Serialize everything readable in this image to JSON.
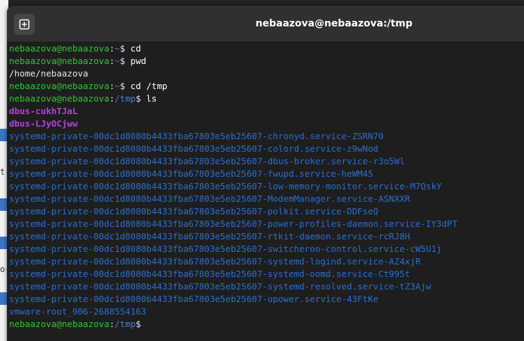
{
  "window": {
    "title": "nebaazova@nebaazova:/tmp",
    "new_tab_icon": "plus-in-square-icon"
  },
  "terminal": {
    "prompt_user": "nebaazova@nebaazova",
    "colors": {
      "user": "#33c534",
      "path": "#3e84d8",
      "sticky_dir": "#b044d8",
      "dir": "#2a6fcf",
      "text": "#e6e6e6"
    },
    "lines": [
      {
        "type": "prompt",
        "path": "~",
        "cmd": " cd"
      },
      {
        "type": "prompt",
        "path": "~",
        "cmd": " pwd"
      },
      {
        "type": "output",
        "text": "/home/nebaazova"
      },
      {
        "type": "prompt",
        "path": "~",
        "cmd": " cd /tmp"
      },
      {
        "type": "prompt",
        "path": "/tmp",
        "cmd": " ls"
      },
      {
        "type": "sticky",
        "text": "dbus-cukhTJaL"
      },
      {
        "type": "sticky",
        "text": "dbus-LJyOCjww"
      },
      {
        "type": "dir",
        "text": "systemd-private-00dc1d8080b4433fba67803e5eb25607-chronyd.service-ZSRN70"
      },
      {
        "type": "dir",
        "text": "systemd-private-00dc1d8080b4433fba67803e5eb25607-colord.service-z9wNod"
      },
      {
        "type": "dir",
        "text": "systemd-private-00dc1d8080b4433fba67803e5eb25607-dbus-broker.service-r3o5Wl"
      },
      {
        "type": "dir",
        "text": "systemd-private-00dc1d8080b4433fba67803e5eb25607-fwupd.service-heWM45"
      },
      {
        "type": "dir",
        "text": "systemd-private-00dc1d8080b4433fba67803e5eb25607-low-memory-monitor.service-M7QskY"
      },
      {
        "type": "dir",
        "text": "systemd-private-00dc1d8080b4433fba67803e5eb25607-ModemManager.service-ASNXXR"
      },
      {
        "type": "dir",
        "text": "systemd-private-00dc1d8080b4433fba67803e5eb25607-polkit.service-DDFseQ"
      },
      {
        "type": "dir",
        "text": "systemd-private-00dc1d8080b4433fba67803e5eb25607-power-profiles-daemon.service-IY3dPT"
      },
      {
        "type": "dir",
        "text": "systemd-private-00dc1d8080b4433fba67803e5eb25607-rtkit-daemon.service-rcRJ8H"
      },
      {
        "type": "dir",
        "text": "systemd-private-00dc1d8080b4433fba67803e5eb25607-switcheroo-control.service-cW5U1j"
      },
      {
        "type": "dir",
        "text": "systemd-private-00dc1d8080b4433fba67803e5eb25607-systemd-logind.service-AZ4xjR"
      },
      {
        "type": "dir",
        "text": "systemd-private-00dc1d8080b4433fba67803e5eb25607-systemd-oomd.service-Ct995t"
      },
      {
        "type": "dir",
        "text": "systemd-private-00dc1d8080b4433fba67803e5eb25607-systemd-resolved.service-tZ3Ajw"
      },
      {
        "type": "dir",
        "text": "systemd-private-00dc1d8080b4433fba67803e5eb25607-upower.service-43FtKe"
      },
      {
        "type": "dir",
        "text": "vmware-root_906-2688554163"
      },
      {
        "type": "prompt",
        "path": "/tmp",
        "cmd": ""
      }
    ]
  },
  "background_window": {
    "visible_chars": [
      {
        "text": "t-",
        "row": 13
      },
      {
        "text": "o(",
        "row": 21
      }
    ]
  }
}
